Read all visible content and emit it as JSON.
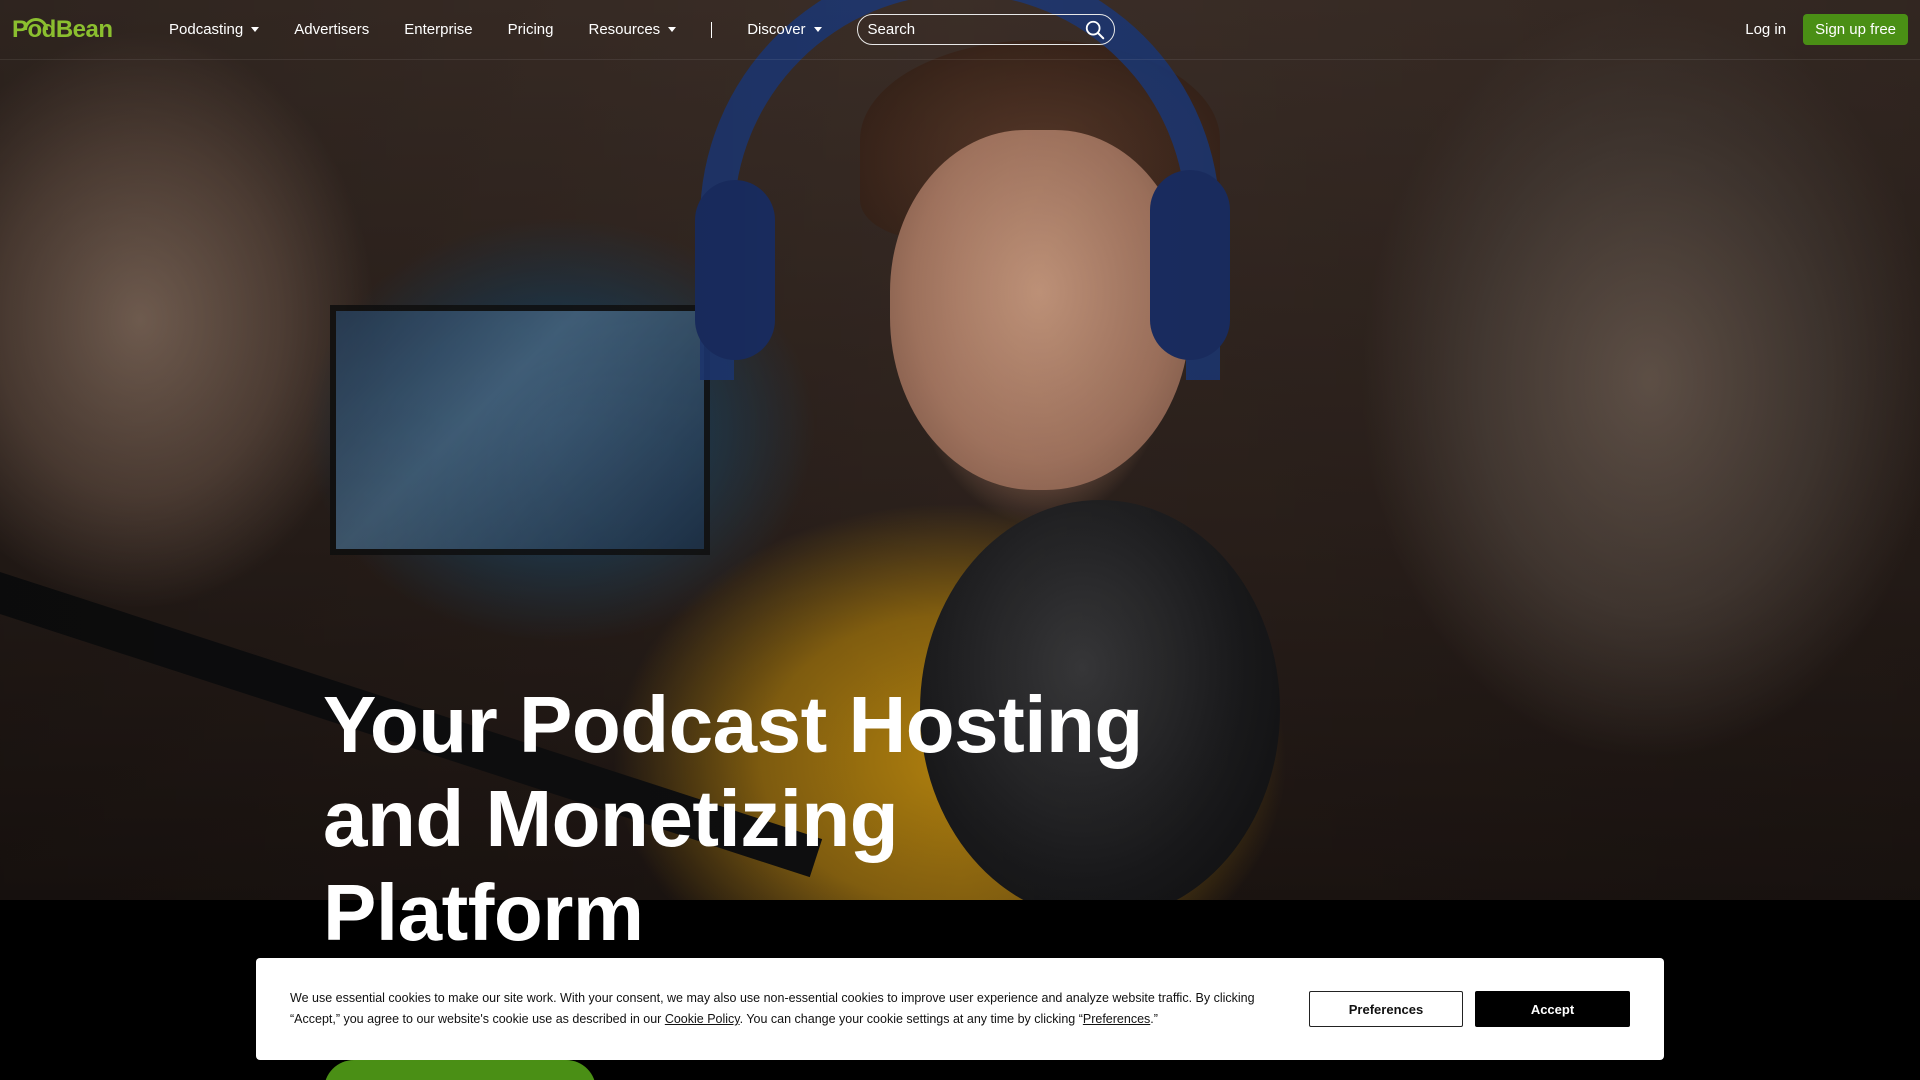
{
  "brand": {
    "logo_text": "PodBean",
    "accent": "#4a8f15",
    "logo_color": "#8bbf2f"
  },
  "nav": {
    "items": [
      {
        "label": "Podcasting",
        "dropdown": true
      },
      {
        "label": "Advertisers",
        "dropdown": false
      },
      {
        "label": "Enterprise",
        "dropdown": false
      },
      {
        "label": "Pricing",
        "dropdown": false
      },
      {
        "label": "Resources",
        "dropdown": true
      }
    ],
    "separator": "|",
    "discover": {
      "label": "Discover",
      "dropdown": true
    }
  },
  "search": {
    "placeholder": "Search",
    "icon": "search-icon"
  },
  "header_right": {
    "login": "Log in",
    "signup": "Sign up free"
  },
  "hero": {
    "title_line1": "Your Podcast Hosting",
    "title_line2": "and Monetizing",
    "title_line3": "Platform"
  },
  "cookie": {
    "text_part1": "We use essential cookies to make our site work. With your consent, we may also use non-essential cookies to improve user experience and analyze website traffic. By clicking “Accept,” you agree to our website's cookie use as described in our ",
    "policy_link": "Cookie Policy",
    "text_part2": ". You can change your cookie settings at any time by clicking “",
    "preferences_link": "Preferences",
    "text_part3": ".”",
    "preferences_button": "Preferences",
    "accept_button": "Accept"
  }
}
